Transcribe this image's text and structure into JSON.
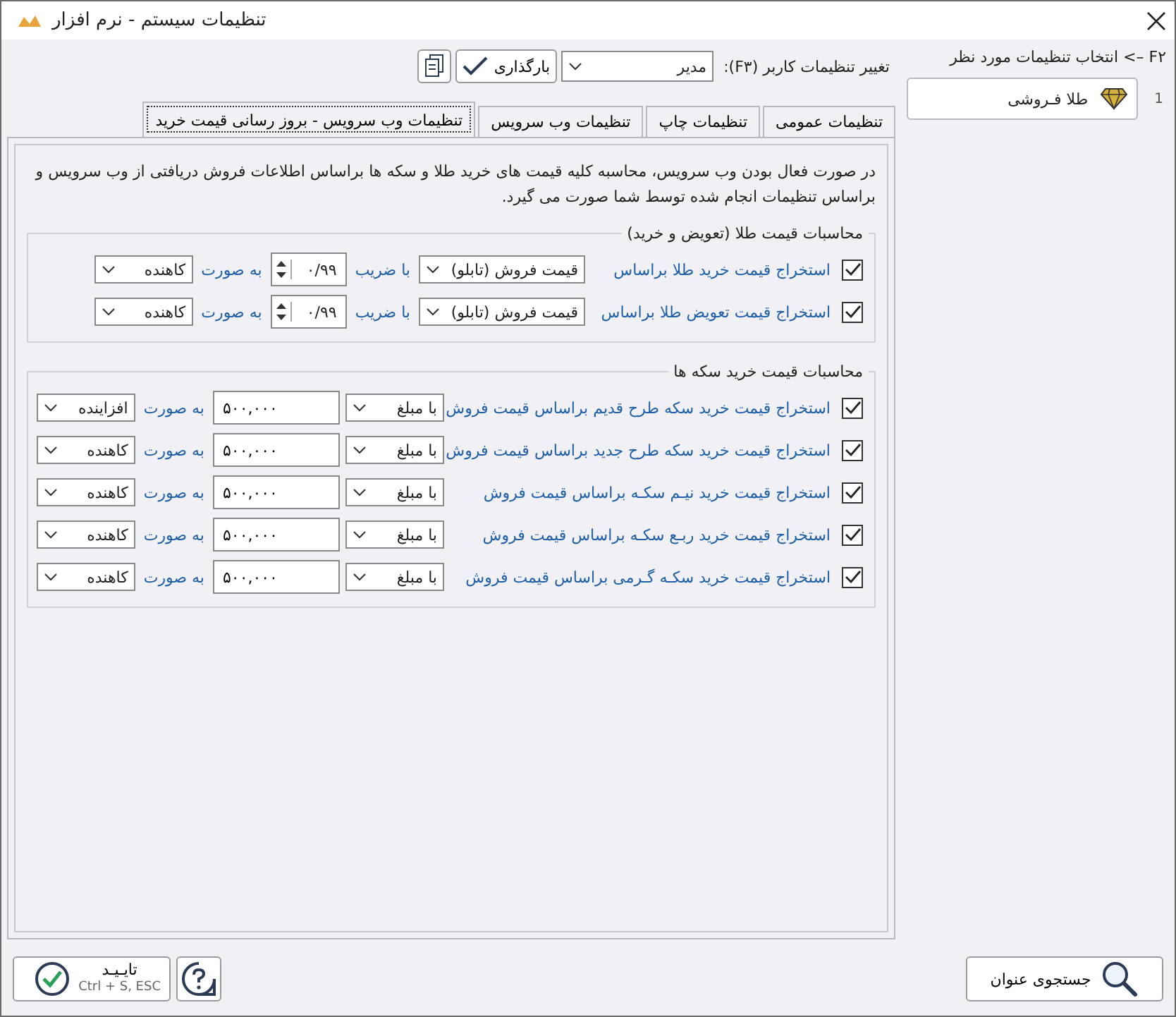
{
  "window": {
    "title": "تنظیمات سیستم - نرم افزار"
  },
  "user_settings": {
    "label": "تغییر تنظیمات کاربر (F۳):",
    "user": "مدیر",
    "load_button": "بارگذاری"
  },
  "tabs": [
    {
      "label": "تنظیمات عمومی",
      "selected": false
    },
    {
      "label": "تنظیمات چاپ",
      "selected": false
    },
    {
      "label": "تنظیمات وب سرویس",
      "selected": false
    },
    {
      "label": "تنظیمات وب سرویس - بروز رسانی قیمت خرید",
      "selected": true
    }
  ],
  "description": "در صورت فعال بودن وب سرویس، محاسبه کلیه قیمت های خرید طلا و سکه ها براساس اطلاعات فروش دریافتی از وب سرویس و براساس تنظیمات انجام شده توسط شما صورت می گیرد.",
  "gold_group": {
    "title": "محاسبات قیمت طلا (تعویض و خرید)",
    "rows": [
      {
        "checked": true,
        "label": "استخراج قیمت خرید طلا براساس",
        "base": "قیمت فروش (تابلو)",
        "factor_label": "با ضریب",
        "factor": "۰/۹۹",
        "mode_label": "به صورت",
        "mode": "کاهنده"
      },
      {
        "checked": true,
        "label": "استخراج قیمت تعویض طلا براساس",
        "base": "قیمت فروش (تابلو)",
        "factor_label": "با ضریب",
        "factor": "۰/۹۹",
        "mode_label": "به صورت",
        "mode": "کاهنده"
      }
    ]
  },
  "coin_group": {
    "title": "محاسبات قیمت خرید سکه ها",
    "rows": [
      {
        "checked": true,
        "label": "استخراج قیمت خرید سکه طرح قدیم براساس قیمت فروش",
        "method": "با مبلغ",
        "amount": "۵۰۰,۰۰۰",
        "mode_label": "به صورت",
        "mode": "افزاینده"
      },
      {
        "checked": true,
        "label": "استخراج قیمت خرید سکه طرح جدید براساس قیمت فروش",
        "method": "با مبلغ",
        "amount": "۵۰۰,۰۰۰",
        "mode_label": "به صورت",
        "mode": "کاهنده"
      },
      {
        "checked": true,
        "label": "استخراج قیمت خرید نیـم سکـه براساس قیمت فروش",
        "method": "با مبلغ",
        "amount": "۵۰۰,۰۰۰",
        "mode_label": "به صورت",
        "mode": "کاهنده"
      },
      {
        "checked": true,
        "label": "استخراج قیمت خرید ربـع سکـه براساس قیمت فروش",
        "method": "با مبلغ",
        "amount": "۵۰۰,۰۰۰",
        "mode_label": "به صورت",
        "mode": "کاهنده"
      },
      {
        "checked": true,
        "label": "استخراج قیمت خرید سکـه گـرمی براساس قیمت فروش",
        "method": "با مبلغ",
        "amount": "۵۰۰,۰۰۰",
        "mode_label": "به صورت",
        "mode": "کاهنده"
      }
    ]
  },
  "sidebar": {
    "hint": "F۲ –> انتخاب تنظیمات مورد نظر",
    "items": [
      {
        "number": "1",
        "label": "طلا فـروشی"
      }
    ]
  },
  "footer": {
    "search_button": "جستجوی عنوان",
    "confirm_button": "تایـیـد",
    "confirm_shortcut": "Ctrl + S, ESC"
  }
}
